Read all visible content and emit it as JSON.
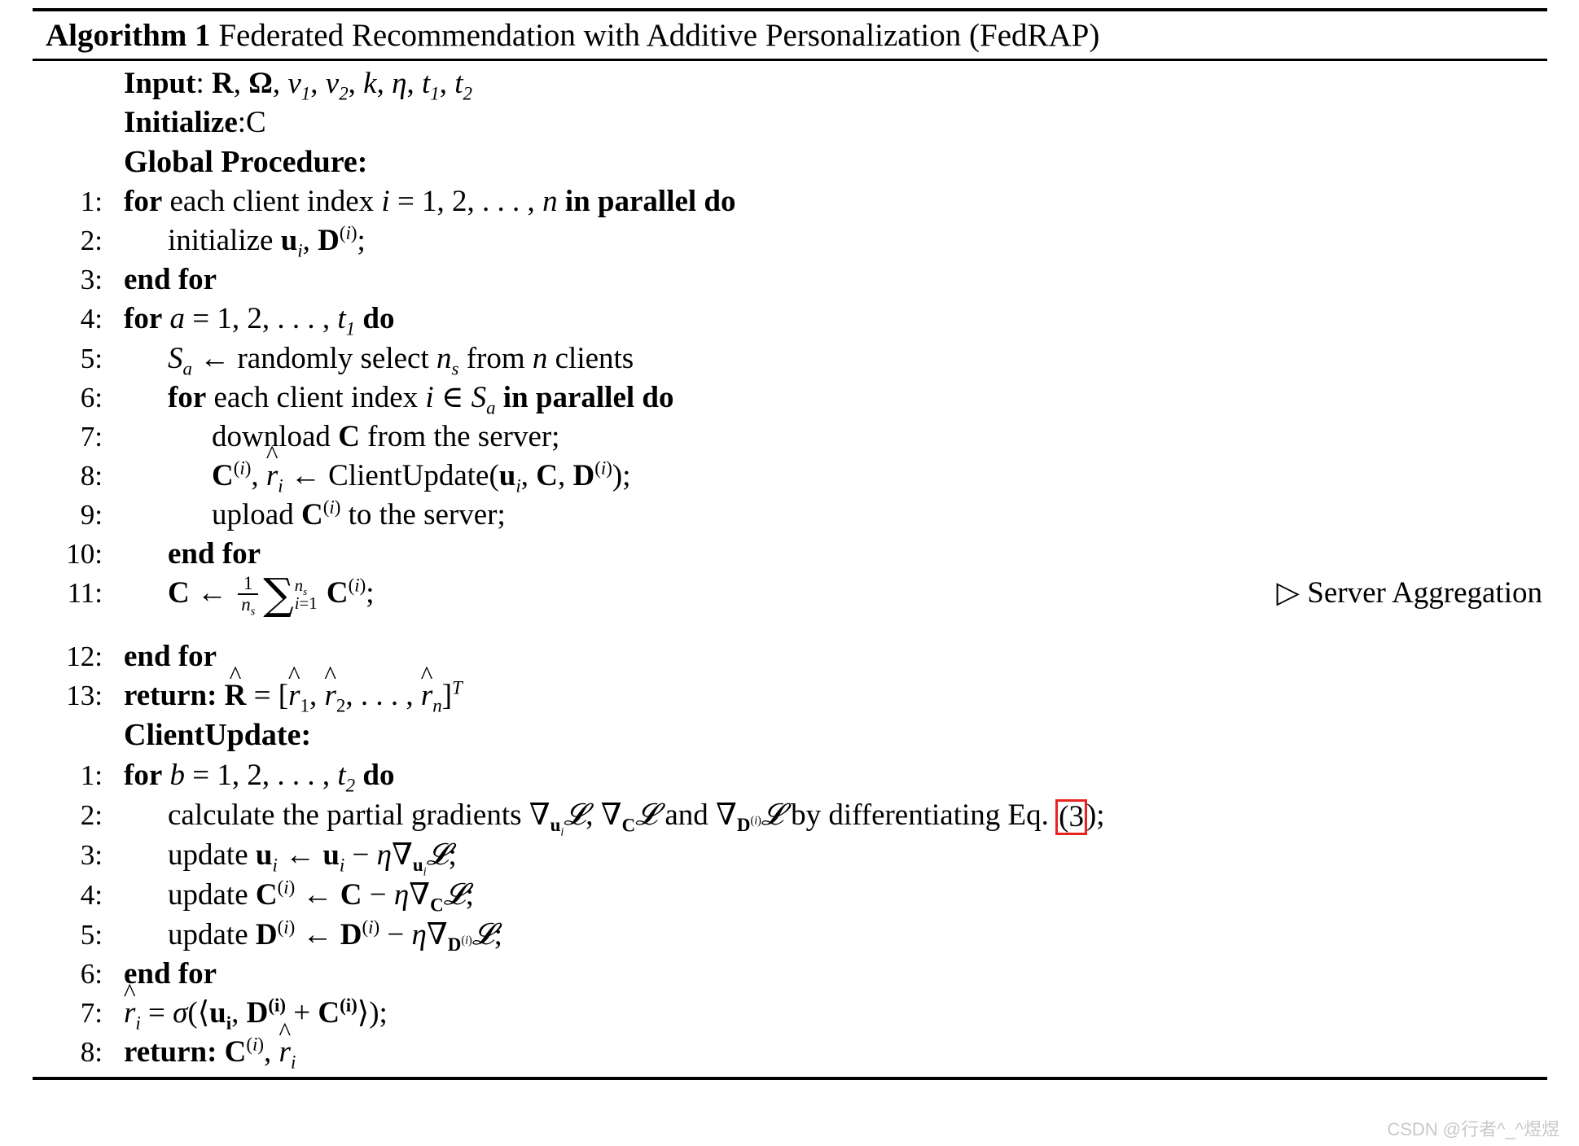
{
  "document": {
    "type": "algorithm-pseudocode",
    "title_prefix": "Algorithm 1",
    "title_text": "Federated Recommendation with Additive Personalization (FedRAP)",
    "watermark": "CSDN @行者^_^煜煜"
  },
  "preamble": {
    "input_label": "Input",
    "input_sep": ": ",
    "input_value": "R, Ω, v₁, v₂, k, η, t₁, t₂",
    "initialize_label": "Initialize",
    "initialize_sep": ":",
    "initialize_value": "C",
    "global_procedure_label": "Global Procedure:"
  },
  "global_procedure": {
    "heading": "Global Procedure:",
    "steps": [
      {
        "num": "1:",
        "indent": 0,
        "text": "for each client index i = 1, 2, . . . , n in parallel do"
      },
      {
        "num": "2:",
        "indent": 1,
        "text": "initialize u_i, D^(i);"
      },
      {
        "num": "3:",
        "indent": 0,
        "text": "end for"
      },
      {
        "num": "4:",
        "indent": 0,
        "text": "for a = 1, 2, . . . , t₁ do"
      },
      {
        "num": "5:",
        "indent": 1,
        "text": "S_a ← randomly select n_s from n clients"
      },
      {
        "num": "6:",
        "indent": 1,
        "text": "for each client index i ∈ S_a in parallel do"
      },
      {
        "num": "7:",
        "indent": 2,
        "text": "download C from the server;"
      },
      {
        "num": "8:",
        "indent": 2,
        "text": "C^(i), r̂_i ← ClientUpdate(u_i, C, D^(i));"
      },
      {
        "num": "9:",
        "indent": 2,
        "text": "upload C^(i) to the server;"
      },
      {
        "num": "10:",
        "indent": 1,
        "text": "end for"
      },
      {
        "num": "11:",
        "indent": 1,
        "text": "C ← (1/n_s) Σ_{i=1}^{n_s} C^(i);",
        "comment": "▷ Server Aggregation"
      },
      {
        "num": "12:",
        "indent": 0,
        "text": "end for"
      },
      {
        "num": "13:",
        "indent": 0,
        "text": "return: R̂ = [r̂₁, r̂₂, . . . , r̂_n]^T"
      }
    ],
    "comment_line11": "Server Aggregation",
    "comment_marker": "▷"
  },
  "client_update": {
    "heading": "ClientUpdate:",
    "steps": [
      {
        "num": "1:",
        "indent": 0,
        "text": "for b = 1, 2, . . . , t₂ do"
      },
      {
        "num": "2:",
        "indent": 1,
        "text": "calculate the partial gradients ∇_{u_i}L, ∇_C L and ∇_{D^(i)} L by differentiating Eq. (3);",
        "highlight": "(3"
      },
      {
        "num": "3:",
        "indent": 1,
        "text": "update u_i ← u_i − η∇_{u_i}L;"
      },
      {
        "num": "4:",
        "indent": 1,
        "text": "update C^(i) ← C − η∇_C L;"
      },
      {
        "num": "5:",
        "indent": 1,
        "text": "update D^(i) ← D^(i) − η∇_{D^(i)} L;"
      },
      {
        "num": "6:",
        "indent": 0,
        "text": "end for"
      },
      {
        "num": "7:",
        "indent": 0,
        "text": "r̂_i = σ(⟨u_i, D^(i) + C^(i)⟩);"
      },
      {
        "num": "8:",
        "indent": 0,
        "text": "return: C^(i), r̂_i"
      }
    ]
  },
  "labels": {
    "for": "for",
    "end_for": "end for",
    "do": "do",
    "in_parallel_do": "in parallel do",
    "return": "return:",
    "each_client_index": "each client index",
    "randomly_select": "randomly select",
    "from": "from",
    "clients": "clients",
    "download_c_from_server": "download",
    "server_suffix": "from the server;",
    "upload": "upload",
    "to_the_server": "to the server;",
    "initialize": "initialize",
    "calculate_gradients_pre": "calculate the partial gradients",
    "and": "and",
    "by_differentiating": "by differentiating Eq.",
    "update": "update",
    "client_update_fn": "ClientUpdate",
    "eq_number_open": "(",
    "eq_number": "3",
    "eq_number_close": ");"
  },
  "colors": {
    "text": "#000000",
    "highlight_box": "#e8231f",
    "watermark": "#c9c9c9",
    "background": "#ffffff"
  }
}
